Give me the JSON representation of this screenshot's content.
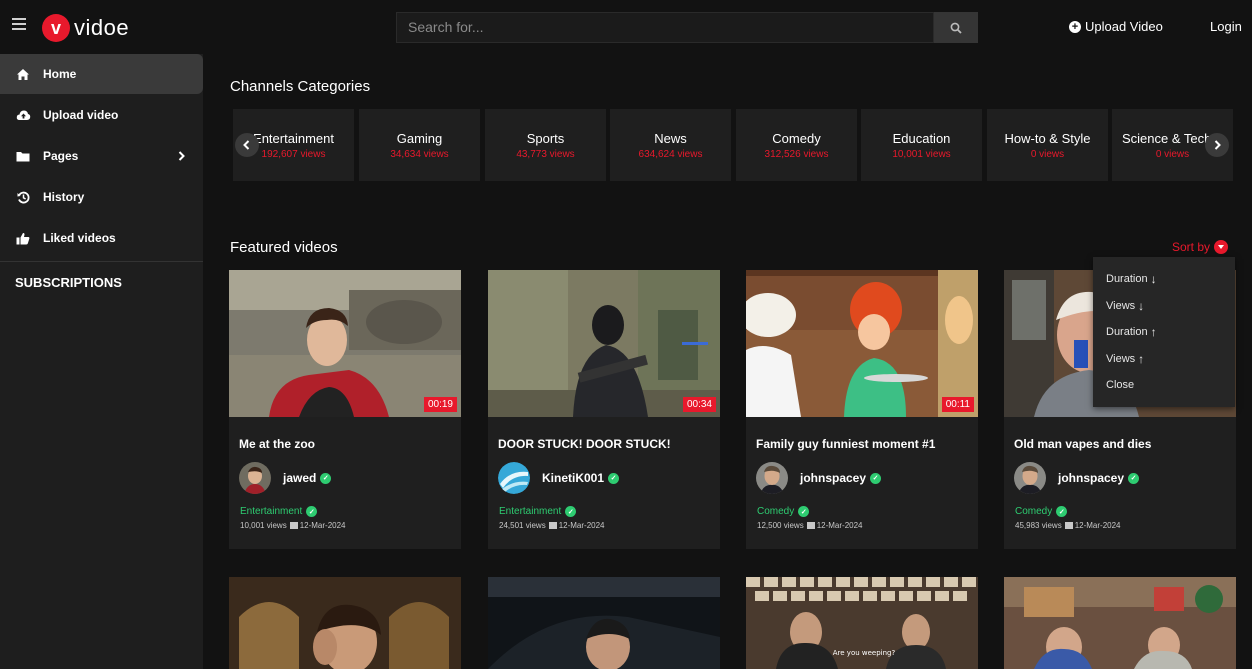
{
  "header": {
    "logo_letter": "v",
    "logo_text": "vidoe",
    "search_placeholder": "Search for...",
    "upload_label": "Upload Video",
    "login_label": "Login"
  },
  "sidebar": {
    "items": [
      {
        "label": "Home",
        "icon": "home-icon"
      },
      {
        "label": "Upload video",
        "icon": "cloud-upload-icon"
      },
      {
        "label": "Pages",
        "icon": "folder-icon"
      },
      {
        "label": "History",
        "icon": "history-icon"
      },
      {
        "label": "Liked videos",
        "icon": "thumbs-up-icon"
      }
    ],
    "subscriptions_title": "SUBSCRIPTIONS"
  },
  "main": {
    "categories_title": "Channels Categories",
    "categories": [
      {
        "name": "Entertainment",
        "views": "192,607 views"
      },
      {
        "name": "Gaming",
        "views": "34,634 views"
      },
      {
        "name": "Sports",
        "views": "43,773 views"
      },
      {
        "name": "News",
        "views": "634,624 views"
      },
      {
        "name": "Comedy",
        "views": "312,526 views"
      },
      {
        "name": "Education",
        "views": "10,001 views"
      },
      {
        "name": "How-to & Style",
        "views": "0 views"
      },
      {
        "name": "Science & Techn",
        "views": "0 views"
      }
    ],
    "featured_title": "Featured videos",
    "sort_label": "Sort by",
    "sort_options": [
      {
        "label": "Duration",
        "arrow": "↓"
      },
      {
        "label": "Views",
        "arrow": "↓"
      },
      {
        "label": "Duration",
        "arrow": "↑"
      },
      {
        "label": "Views",
        "arrow": "↑"
      },
      {
        "label": "Close",
        "arrow": ""
      }
    ],
    "videos": [
      {
        "title": "Me at the zoo",
        "duration": "00:19",
        "author": "jawed",
        "category": "Entertainment",
        "views": "10,001 views",
        "date": "12-Mar-2024"
      },
      {
        "title": "DOOR STUCK! DOOR STUCK!",
        "duration": "00:34",
        "author": "KinetiK001",
        "category": "Entertainment",
        "views": "24,501 views",
        "date": "12-Mar-2024"
      },
      {
        "title": "Family guy funniest moment #1",
        "duration": "00:11",
        "author": "johnspacey",
        "category": "Comedy",
        "views": "12,500 views",
        "date": "12-Mar-2024"
      },
      {
        "title": "Old man vapes and dies",
        "duration": "",
        "author": "johnspacey",
        "category": "Comedy",
        "views": "45,983 views",
        "date": "12-Mar-2024"
      }
    ],
    "row2_caption": "Are you weeping?"
  },
  "colors": {
    "accent": "#e8192c",
    "verified": "#2ecc71",
    "background": "#121212",
    "sidebar": "#1e1e1e",
    "card": "#1f1f1f"
  }
}
